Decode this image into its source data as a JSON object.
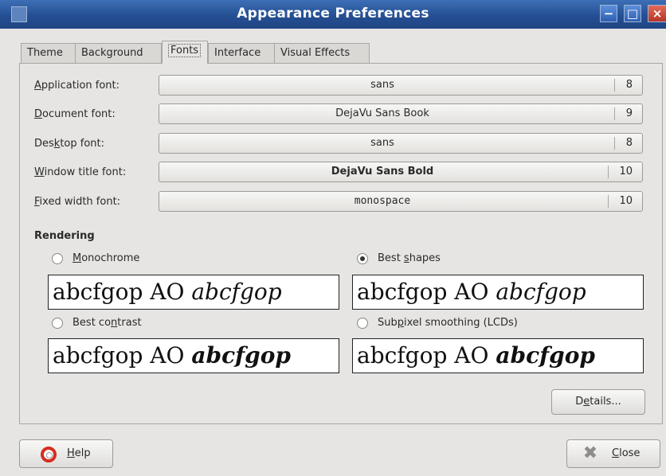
{
  "window": {
    "title": "Appearance Preferences"
  },
  "tabs": [
    {
      "label": "Theme"
    },
    {
      "label": "Background"
    },
    {
      "label": "Fonts"
    },
    {
      "label": "Interface"
    },
    {
      "label": "Visual Effects"
    }
  ],
  "active_tab": "Fonts",
  "fonts": [
    {
      "label_pre": "",
      "mnemonic": "A",
      "label_post": "pplication font:",
      "name": "sans",
      "size": "8"
    },
    {
      "label_pre": "",
      "mnemonic": "D",
      "label_post": "ocument font:",
      "name": "DejaVu Sans Book",
      "size": "9"
    },
    {
      "label_pre": "Des",
      "mnemonic": "k",
      "label_post": "top font:",
      "name": "sans",
      "size": "8"
    },
    {
      "label_pre": "",
      "mnemonic": "W",
      "label_post": "indow title font:",
      "name": "DejaVu Sans Bold",
      "size": "10"
    },
    {
      "label_pre": "",
      "mnemonic": "F",
      "label_post": "ixed width font:",
      "name": "monospace",
      "size": "10"
    }
  ],
  "rendering": {
    "heading": "Rendering",
    "options": [
      {
        "label_pre": "",
        "mnemonic": "M",
        "label_post": "onochrome",
        "selected": false
      },
      {
        "label_pre": "Best ",
        "mnemonic": "s",
        "label_post": "hapes",
        "selected": true
      },
      {
        "label_pre": "Best co",
        "mnemonic": "n",
        "label_post": "trast",
        "selected": false
      },
      {
        "label_pre": "Sub",
        "mnemonic": "p",
        "label_post": "ixel smoothing (LCDs)",
        "selected": false
      }
    ],
    "sample_plain": "abcfgop AO ",
    "sample_italic": "abcfgop"
  },
  "buttons": {
    "details_pre": "D",
    "details_mnemonic": "e",
    "details_post": "tails...",
    "help_mnemonic": "H",
    "help_post": "elp",
    "close_mnemonic": "C",
    "close_post": "lose"
  },
  "icons": {
    "help": "lifebuoy-icon",
    "close": "close-x-icon"
  }
}
